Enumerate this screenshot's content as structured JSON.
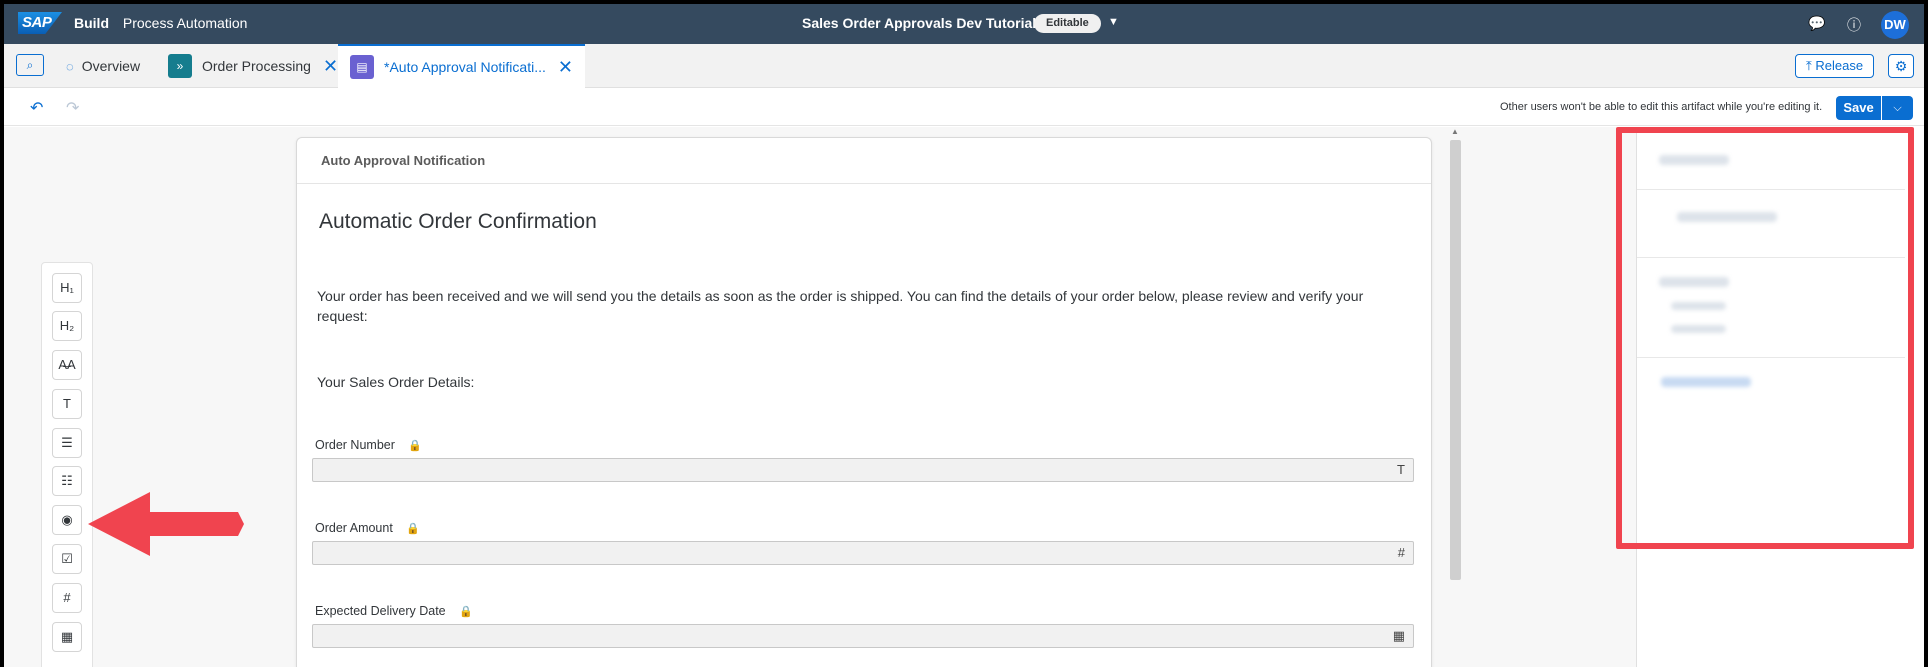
{
  "shell": {
    "logo": "SAP",
    "product": "Build",
    "app": "Process Automation",
    "project_title": "Sales Order Approvals Dev Tutorial",
    "status_badge": "Editable",
    "user_initials": "DW",
    "icons": [
      "feedback-icon",
      "help-icon"
    ]
  },
  "tabs": [
    {
      "label": "Overview",
      "closable": false,
      "active": false
    },
    {
      "label": "Order Processing",
      "closable": true,
      "active": false
    },
    {
      "label": "*Auto Approval Notificati...",
      "closable": true,
      "active": true
    }
  ],
  "tabbar": {
    "release_label": "Release"
  },
  "toolbar": {
    "edit_note": "Other users won't be able to edit this artifact while you're editing it.",
    "save_label": "Save"
  },
  "palette": {
    "items": [
      {
        "glyph": "H₁",
        "icon": "heading1-icon"
      },
      {
        "glyph": "H₂",
        "icon": "heading2-icon"
      },
      {
        "glyph": "A̶A",
        "icon": "paragraph-style-icon"
      },
      {
        "glyph": "T",
        "icon": "text-field-icon"
      },
      {
        "glyph": "☰",
        "icon": "paragraph-icon"
      },
      {
        "glyph": "☷",
        "icon": "checklist-icon"
      },
      {
        "glyph": "◉",
        "icon": "radio-icon"
      },
      {
        "glyph": "☑",
        "icon": "checkbox-icon"
      },
      {
        "glyph": "#",
        "icon": "number-icon"
      },
      {
        "glyph": "▦",
        "icon": "date-icon"
      }
    ]
  },
  "form": {
    "header": "Auto Approval Notification",
    "title": "Automatic Order Confirmation",
    "body": "Your order has been received and we will send you the details as soon as the order is shipped. You can find the details of your order below, please review and verify your request:",
    "details_heading": "Your Sales Order Details:",
    "fields": [
      {
        "label": "Order Number",
        "type_icon": "T"
      },
      {
        "label": "Order Amount",
        "type_icon": "#"
      },
      {
        "label": "Expected Delivery Date",
        "type_icon": "▦"
      }
    ]
  }
}
